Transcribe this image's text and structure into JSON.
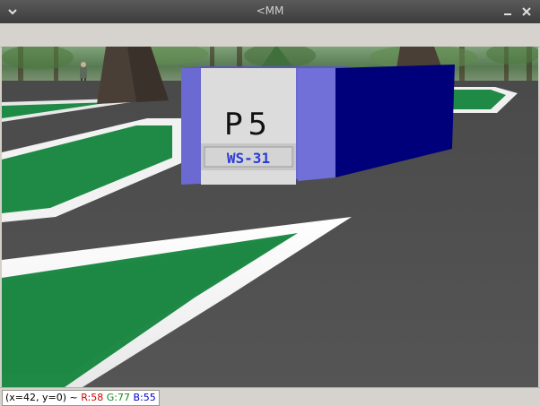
{
  "window": {
    "title": "<MM",
    "icons": {
      "menu": "chevron-down-icon",
      "minimize": "minimize-icon",
      "close": "close-icon"
    }
  },
  "scene": {
    "block_label": "P5",
    "plate_text": "WS-31"
  },
  "status": {
    "coords": "(x=42, y=0)",
    "separator": "~",
    "r": "R:58",
    "g": "G:77",
    "b": "B:55"
  },
  "colors": {
    "ground": "#4e4e4e",
    "field_green": "#1e8a46",
    "line_white": "#f2f2f2",
    "block_front": "#6666cc",
    "block_side": "#00007a",
    "plate_text": "#2a3cd6"
  }
}
